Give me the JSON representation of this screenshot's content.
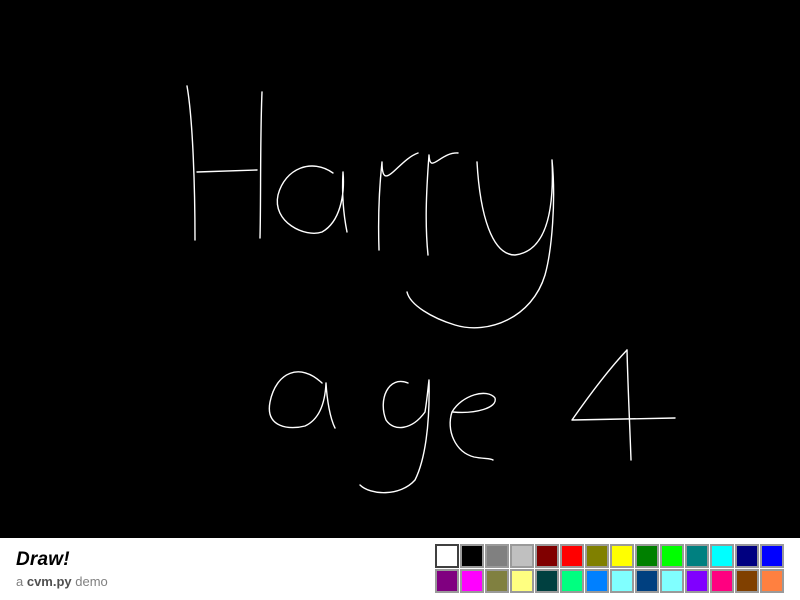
{
  "app": {
    "title": "Draw!",
    "subtitle_prefix": "a ",
    "subtitle_brand": "cvm.py",
    "subtitle_suffix": " demo"
  },
  "canvas": {
    "background": "#000000",
    "stroke_color": "#ffffff"
  },
  "palette": {
    "selected_index": 0,
    "colors": [
      "#ffffff",
      "#000000",
      "#808080",
      "#c0c0c0",
      "#800000",
      "#ff0000",
      "#808000",
      "#ffff00",
      "#008000",
      "#00ff00",
      "#008080",
      "#00ffff",
      "#000080",
      "#0000ff",
      "#800080",
      "#ff00ff",
      "#808040",
      "#ffff80",
      "#004040",
      "#00ff80",
      "#0080ff",
      "#80ffff",
      "#004080",
      "#80ffff",
      "#8000ff",
      "#ff0080",
      "#804000",
      "#ff8040"
    ]
  }
}
